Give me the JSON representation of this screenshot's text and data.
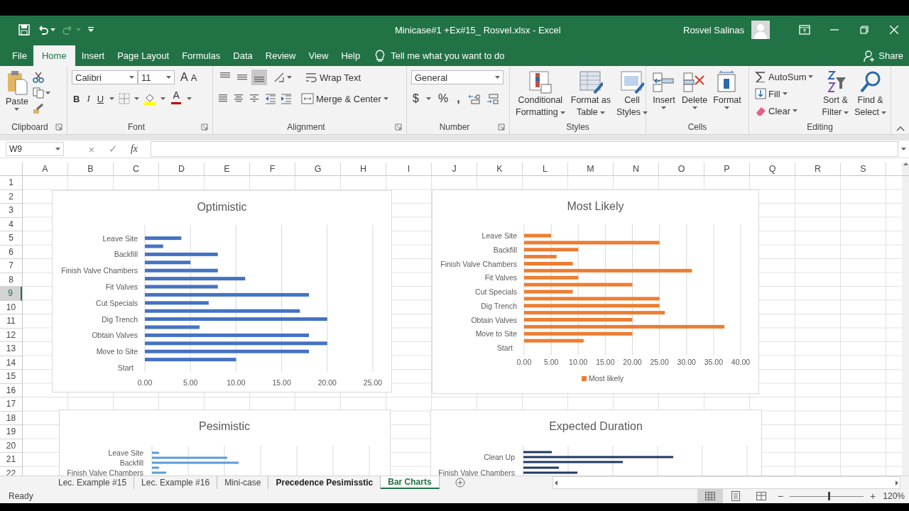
{
  "window": {
    "title": "Minicase#1 +Ex#15_ Rosvel.xlsx  -  Excel",
    "user": "Rosvel Salinas"
  },
  "ribbon_tabs": [
    {
      "label": "File",
      "selected": false
    },
    {
      "label": "Home",
      "selected": true
    },
    {
      "label": "Insert",
      "selected": false
    },
    {
      "label": "Page Layout",
      "selected": false
    },
    {
      "label": "Formulas",
      "selected": false
    },
    {
      "label": "Data",
      "selected": false
    },
    {
      "label": "Review",
      "selected": false
    },
    {
      "label": "View",
      "selected": false
    },
    {
      "label": "Help",
      "selected": false
    }
  ],
  "tell_me": "Tell me what you want to do",
  "share": "Share",
  "ribbon_groups": [
    {
      "kind": "clipboard",
      "label": "Clipboard",
      "paste": "Paste"
    },
    {
      "kind": "font",
      "label": "Font",
      "font_name": "Calibri",
      "font_size": "11",
      "grow": "A",
      "shrink": "A",
      "bold": "B",
      "italic": "I",
      "underline": "U",
      "font_color": "A"
    },
    {
      "kind": "alignment",
      "label": "Alignment",
      "vertical_align": [
        {
          "selected": false
        },
        {
          "selected": false
        },
        {
          "selected": true
        }
      ],
      "wrap": "Wrap Text",
      "merge": "Merge & Center"
    },
    {
      "kind": "number",
      "label": "Number",
      "format": "General",
      "currency": "$",
      "percent": "%",
      "comma": ","
    },
    {
      "kind": "styles",
      "label": "Styles",
      "buttons": [
        {
          "lines": [
            "Conditional",
            "Formatting"
          ]
        },
        {
          "lines": [
            "Format as",
            "Table"
          ]
        },
        {
          "lines": [
            "Cell",
            "Styles"
          ]
        }
      ]
    },
    {
      "kind": "cells",
      "label": "Cells",
      "buttons": [
        {
          "lines": [
            "Insert"
          ]
        },
        {
          "lines": [
            "Delete"
          ]
        },
        {
          "lines": [
            "Format"
          ]
        }
      ]
    },
    {
      "kind": "editing",
      "label": "Editing",
      "small": [
        "AutoSum",
        "Fill",
        "Clear"
      ],
      "buttons": [
        {
          "lines": [
            "Sort &",
            "Filter"
          ]
        },
        {
          "lines": [
            "Find &",
            "Select"
          ]
        }
      ]
    }
  ],
  "formula_bar": {
    "name_box": "W9",
    "cancel": "×",
    "enter": "✓",
    "function": "fx"
  },
  "columns": [
    "A",
    "B",
    "C",
    "D",
    "E",
    "F",
    "G",
    "H",
    "I",
    "J",
    "K",
    "L",
    "M",
    "N",
    "O",
    "P",
    "Q",
    "R",
    "S"
  ],
  "rows": [
    {
      "label": "1",
      "selected": false
    },
    {
      "label": "2",
      "selected": false
    },
    {
      "label": "3",
      "selected": false
    },
    {
      "label": "4",
      "selected": false
    },
    {
      "label": "5",
      "selected": false
    },
    {
      "label": "6",
      "selected": false
    },
    {
      "label": "7",
      "selected": false
    },
    {
      "label": "8",
      "selected": false
    },
    {
      "label": "9",
      "selected": true
    },
    {
      "label": "10",
      "selected": false
    },
    {
      "label": "11",
      "selected": false
    },
    {
      "label": "12",
      "selected": false
    },
    {
      "label": "13",
      "selected": false
    },
    {
      "label": "14",
      "selected": false
    },
    {
      "label": "15",
      "selected": false
    },
    {
      "label": "16",
      "selected": false
    },
    {
      "label": "17",
      "selected": false
    },
    {
      "label": "18",
      "selected": false
    },
    {
      "label": "19",
      "selected": false
    },
    {
      "label": "20",
      "selected": false
    },
    {
      "label": "21",
      "selected": false
    },
    {
      "label": "22",
      "selected": false
    }
  ],
  "charts": [
    {
      "kind": "bar_chart",
      "chart_data": {
        "type": "bar",
        "orientation": "horizontal",
        "title": "Optimistic",
        "grid": true,
        "categories": [
          "Leave Site",
          null,
          "Backfill",
          null,
          "Finish Valve Chambers",
          null,
          "Fit Valves",
          null,
          "Cut Specials",
          null,
          "Dig Trench",
          null,
          "Obtain Valves",
          null,
          "Move to Site",
          null,
          "Start"
        ],
        "series": [
          {
            "color": "#4472c4",
            "values": [
              4,
              2,
              8,
              5,
              8,
              11,
              8,
              18,
              7,
              17,
              20,
              6,
              18,
              20,
              18,
              10,
              0
            ]
          }
        ],
        "xlim": [
          0,
          25
        ],
        "xticks": [
          {
            "value": 0,
            "label": "0.00"
          },
          {
            "value": 5,
            "label": "5.00"
          },
          {
            "value": 10,
            "label": "10.00"
          },
          {
            "value": 15,
            "label": "15.00"
          },
          {
            "value": 20,
            "label": "20.00"
          },
          {
            "value": 25,
            "label": "25.00"
          }
        ]
      }
    },
    {
      "kind": "bar_chart",
      "chart_data": {
        "type": "bar",
        "orientation": "horizontal",
        "title": "Most Likely",
        "grid": true,
        "categories": [
          "Leave Site",
          null,
          "Backfill",
          null,
          "Finish Valve Chambers",
          null,
          "Fit Valves",
          null,
          "Cut Specials",
          null,
          "Dig Trench",
          null,
          "Obtain Valves",
          null,
          "Move to Site",
          null,
          "Start"
        ],
        "series": [
          {
            "name": "Most likely",
            "color": "#ed7d31",
            "values": [
              5,
              25,
              10,
              6,
              9,
              31,
              10,
              20,
              9,
              25,
              25,
              26,
              20,
              37,
              20,
              11,
              0
            ]
          }
        ],
        "xlim": [
          0,
          40
        ],
        "xticks": [
          {
            "value": 0,
            "label": "0.00"
          },
          {
            "value": 5,
            "label": "5.00"
          },
          {
            "value": 10,
            "label": "10.00"
          },
          {
            "value": 15,
            "label": "15.00"
          },
          {
            "value": 20,
            "label": "20.00"
          },
          {
            "value": 25,
            "label": "25.00"
          },
          {
            "value": 30,
            "label": "30.00"
          },
          {
            "value": 35,
            "label": "35.00"
          },
          {
            "value": 40,
            "label": "40.00"
          }
        ]
      }
    },
    {
      "kind": "picture_chart",
      "title": "Pesimistic",
      "labels": [
        "Leave Site",
        "Backfill",
        "Finish Valve Chambers"
      ]
    },
    {
      "kind": "picture_chart",
      "title": "Expected Duration",
      "labels": [
        "Clean Up",
        "Finish Valve Chambers"
      ]
    }
  ],
  "sheet_tabs": [
    {
      "label": "Lec. Example #15",
      "selected": false,
      "bold": false
    },
    {
      "label": "Lec. Example #16",
      "selected": false,
      "bold": false
    },
    {
      "label": "Mini-case",
      "selected": false,
      "bold": false
    },
    {
      "label": "Precedence Pesimisstic",
      "selected": false,
      "bold": true
    },
    {
      "label": "Bar Charts",
      "selected": true,
      "bold": true
    }
  ],
  "status_bar": {
    "status": "Ready",
    "zoom_out": "−",
    "zoom_in": "+",
    "zoom": "120%",
    "zoom_slider": {
      "level": 0.52
    }
  }
}
